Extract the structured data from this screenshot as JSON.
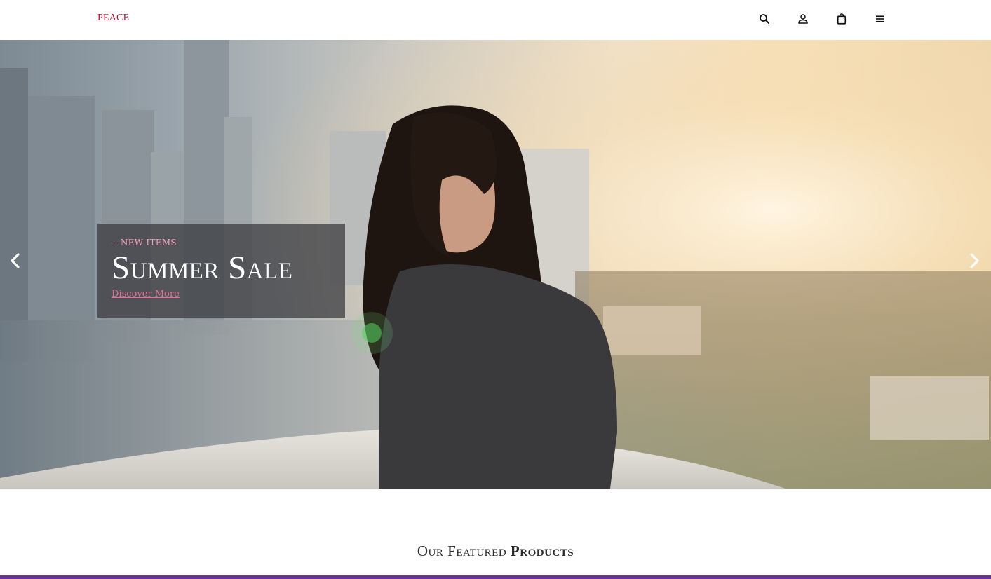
{
  "header": {
    "logo": "PEACE",
    "icons": [
      "search-icon",
      "user-icon",
      "bag-icon",
      "menu-icon"
    ]
  },
  "hero": {
    "subtitle": "-- NEW ITEMS",
    "title": "Summer Sale",
    "link": "Discover More",
    "prev_icon": "chevron-left-icon",
    "next_icon": "chevron-right-icon"
  },
  "featured": {
    "title_part1": "Our Featured",
    "title_part2": "Products"
  },
  "colors": {
    "brand": "#b01236",
    "accent_link": "#e86f93",
    "bottom_bar": "#6a2fa0"
  }
}
